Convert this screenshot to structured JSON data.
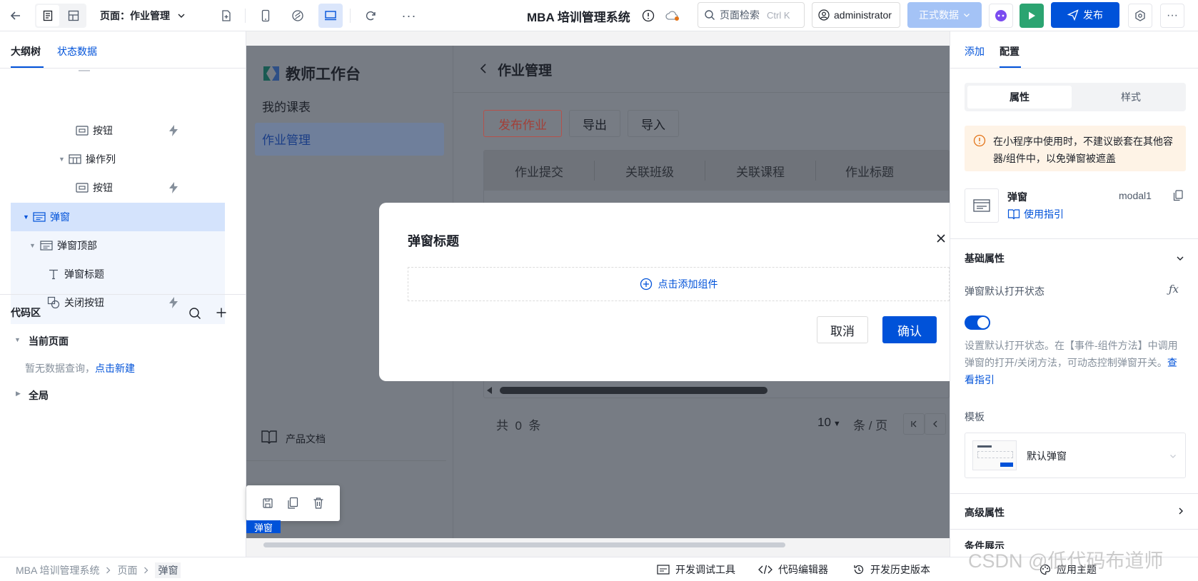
{
  "topbar": {
    "page_label": "页面：作业管理",
    "app_title": "MBA 培训管理系统",
    "search_placeholder": "页面检索",
    "search_shortcut": "Ctrl K",
    "user": "administrator",
    "env_label": "正式数据",
    "publish_label": "发布"
  },
  "left": {
    "tabs": [
      "大纲树",
      "状态数据"
    ],
    "tree": [
      {
        "label": "按钮",
        "icon": "button-icon"
      },
      {
        "label": "操作列",
        "icon": "table-icon"
      },
      {
        "label": "按钮",
        "icon": "button-icon"
      },
      {
        "label": "弹窗",
        "icon": "modal-icon"
      },
      {
        "label": "弹窗顶部",
        "icon": "modal-icon"
      },
      {
        "label": "弹窗标题",
        "icon": "text-icon"
      },
      {
        "label": "关闭按钮",
        "icon": "shapes-icon"
      }
    ],
    "code_title": "代码区",
    "current_page": "当前页面",
    "no_query": "暂无数据查询，",
    "create_link": "点击新建",
    "global": "全局"
  },
  "canvas": {
    "brand": "教师工作台",
    "nav": [
      "我的课表",
      "作业管理"
    ],
    "page_title": "作业管理",
    "buttons": [
      "发布作业",
      "导出",
      "导入"
    ],
    "columns": [
      "作业提交",
      "关联班级",
      "关联课程",
      "作业标题"
    ],
    "total": "共  0  条",
    "page_size": "10",
    "per_page": "条 / 页",
    "docs": "产品文档",
    "tag": "弹窗",
    "modal": {
      "title": "弹窗标题",
      "add_component": "点击添加组件",
      "cancel": "取消",
      "confirm": "确认"
    }
  },
  "right": {
    "tabs": [
      "添加",
      "配置"
    ],
    "seg": [
      "属性",
      "样式"
    ],
    "warning": "在小程序中使用时，不建议嵌套在其他容器/组件中，以免弹窗被遮盖",
    "component_name": "弹窗",
    "component_id": "modal1",
    "guide_link": "使用指引",
    "basic_props": "基础属性",
    "default_open_label": "弹窗默认打开状态",
    "desc": "设置默认打开状态。在【事件-组件方法】中调用弹窗的打开/关闭方法，可动态控制弹窗开关。",
    "see_guide": "查看指引",
    "template_label": "模板",
    "template_value": "默认弹窗",
    "advanced": "高级属性",
    "condition": "条件展示"
  },
  "statusbar": {
    "breadcrumb": [
      "MBA 培训管理系统",
      "页面",
      "弹窗"
    ],
    "tools": [
      "开发调试工具",
      "代码编辑器",
      "开发历史版本",
      "应用主题"
    ],
    "watermark": "CSDN @低代码布道师"
  },
  "colors": {
    "accent": "#0052d9",
    "danger": "#d54941",
    "green": "#2ba471"
  }
}
